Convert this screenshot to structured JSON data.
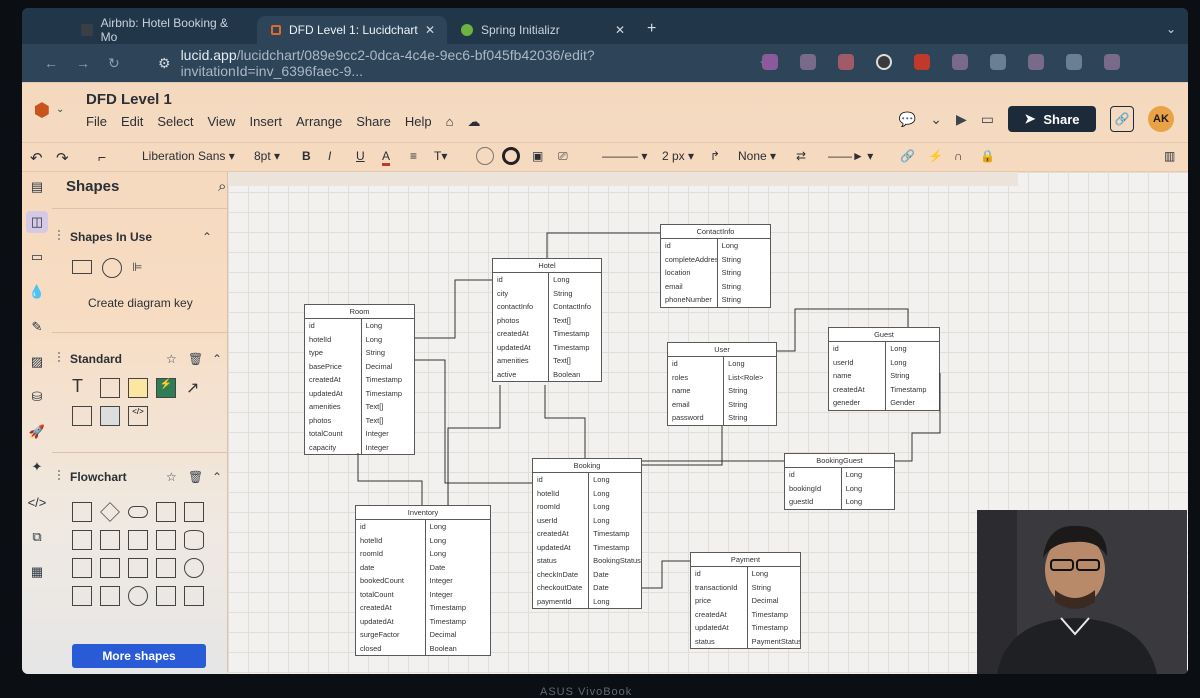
{
  "browser": {
    "tabs": [
      {
        "label": "Airbnb: Hotel Booking & Mo",
        "active": false
      },
      {
        "label": "DFD Level 1: Lucidchart",
        "active": true
      },
      {
        "label": "Spring Initializr",
        "active": false
      }
    ],
    "new_tab": "+",
    "url_main": "lucid.app",
    "url_rest": "/lucidchart/089e9cc2-0dca-4c4e-9ec6-bf045fb42036/edit?invitationId=inv_6396faec-9..."
  },
  "app": {
    "title": "DFD Level 1",
    "menu": [
      "File",
      "Edit",
      "Select",
      "View",
      "Insert",
      "Arrange",
      "Share",
      "Help"
    ],
    "share_label": "Share",
    "avatar_initials": "AK",
    "accent": "#1d2a3a"
  },
  "toolbar": {
    "font": "Liberation Sans",
    "font_size": "8pt",
    "line_width": "2 px",
    "endpoint": "None"
  },
  "panel": {
    "title": "Shapes",
    "sections": {
      "in_use": "Shapes In Use",
      "standard": "Standard",
      "flowchart": "Flowchart"
    },
    "diagram_key": "Create diagram key",
    "more_shapes": "More shapes"
  },
  "entities": [
    {
      "name": "Room",
      "rows": [
        [
          "id",
          "Long"
        ],
        [
          "hotelId",
          "Long"
        ],
        [
          "type",
          "String"
        ],
        [
          "basePrice",
          "Decimal"
        ],
        [
          "createdAt",
          "Timestamp"
        ],
        [
          "updatedAt",
          "Timestamp"
        ],
        [
          "amenities",
          "Text[]"
        ],
        [
          "photos",
          "Text[]"
        ],
        [
          "totalCount",
          "Integer"
        ],
        [
          "capacity",
          "Integer"
        ]
      ]
    },
    {
      "name": "Hotel",
      "rows": [
        [
          "id",
          "Long"
        ],
        [
          "city",
          "String"
        ],
        [
          "contactInfo",
          "ContactInfo"
        ],
        [
          "photos",
          "Text[]"
        ],
        [
          "createdAt",
          "Timestamp"
        ],
        [
          "updatedAt",
          "Timestamp"
        ],
        [
          "amenities",
          "Text[]"
        ],
        [
          "active",
          "Boolean"
        ]
      ]
    },
    {
      "name": "ContactInfo",
      "rows": [
        [
          "id",
          "Long"
        ],
        [
          "completeAddress",
          "String"
        ],
        [
          "location",
          "String"
        ],
        [
          "email",
          "String"
        ],
        [
          "phoneNumber",
          "String"
        ]
      ]
    },
    {
      "name": "User",
      "rows": [
        [
          "id",
          "Long"
        ],
        [
          "roles",
          "List<Role>"
        ],
        [
          "name",
          "String"
        ],
        [
          "email",
          "String"
        ],
        [
          "password",
          "String"
        ]
      ]
    },
    {
      "name": "Guest",
      "rows": [
        [
          "id",
          "Long"
        ],
        [
          "userId",
          "Long"
        ],
        [
          "name",
          "String"
        ],
        [
          "createdAt",
          "Timestamp"
        ],
        [
          "geneder",
          "Gender"
        ]
      ]
    },
    {
      "name": "BookingGuest",
      "rows": [
        [
          "id",
          "Long"
        ],
        [
          "bookingId",
          "Long"
        ],
        [
          "guestId",
          "Long"
        ]
      ]
    },
    {
      "name": "Booking",
      "rows": [
        [
          "id",
          "Long"
        ],
        [
          "hotelId",
          "Long"
        ],
        [
          "roomId",
          "Long"
        ],
        [
          "userId",
          "Long"
        ],
        [
          "createdAt",
          "Timestamp"
        ],
        [
          "updatedAt",
          "Timestamp"
        ],
        [
          "status",
          "BookingStatus"
        ],
        [
          "checkInDate",
          "Date"
        ],
        [
          "checkoutDate",
          "Date"
        ],
        [
          "paymentId",
          "Long"
        ]
      ]
    },
    {
      "name": "Inventory",
      "rows": [
        [
          "id",
          "Long"
        ],
        [
          "hotelId",
          "Long"
        ],
        [
          "roomId",
          "Long"
        ],
        [
          "date",
          "Date"
        ],
        [
          "bookedCount",
          "Integer"
        ],
        [
          "totalCount",
          "Integer"
        ],
        [
          "createdAt",
          "Timestamp"
        ],
        [
          "updatedAt",
          "Timestamp"
        ],
        [
          "surgeFactor",
          "Decimal"
        ],
        [
          "closed",
          "Boolean"
        ]
      ]
    },
    {
      "name": "Payment",
      "rows": [
        [
          "id",
          "Long"
        ],
        [
          "transactionId",
          "String"
        ],
        [
          "price",
          "Decimal"
        ],
        [
          "createdAt",
          "Timestamp"
        ],
        [
          "updatedAt",
          "Timestamp"
        ],
        [
          "status",
          "PaymentStatus"
        ]
      ]
    }
  ],
  "laptop_brand": "ASUS VivoBook"
}
